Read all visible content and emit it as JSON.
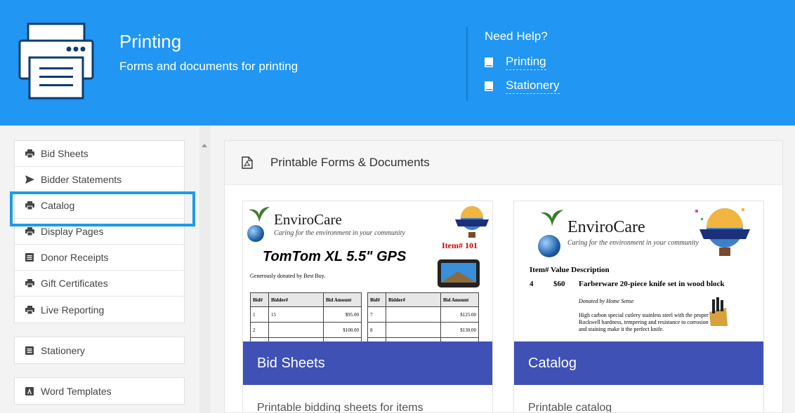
{
  "header": {
    "title": "Printing",
    "subtitle": "Forms and documents for printing",
    "help_title": "Need Help?",
    "help_links": [
      "Printing",
      "Stationery"
    ],
    "bg_color": "#2196f3"
  },
  "sidebar": {
    "group1": [
      {
        "label": "Bid Sheets",
        "icon": "printer-icon"
      },
      {
        "label": "Bidder Statements",
        "icon": "send-icon"
      },
      {
        "label": "Catalog",
        "icon": "printer-icon",
        "active": true
      },
      {
        "label": "Display Pages",
        "icon": "printer-icon"
      },
      {
        "label": "Donor Receipts",
        "icon": "list-icon"
      },
      {
        "label": "Gift Certificates",
        "icon": "printer-icon"
      },
      {
        "label": "Live Reporting",
        "icon": "printer-icon"
      }
    ],
    "group2": [
      {
        "label": "Stationery",
        "icon": "list-icon"
      }
    ],
    "group3": [
      {
        "label": "Word Templates",
        "icon": "word-icon"
      }
    ],
    "highlight_color": "#1e9be8"
  },
  "main": {
    "panel_title": "Printable Forms & Documents",
    "cards": [
      {
        "title": "Bid Sheets",
        "desc": "Printable bidding sheets for items"
      },
      {
        "title": "Catalog",
        "desc": "Printable catalog"
      }
    ],
    "card_bar_color": "#3f51b5"
  },
  "thumb_bids": {
    "brand": "EnviroCare",
    "tagline": "Caring for the environment in your community",
    "headline": "TomTom XL 5.5\" GPS",
    "item_no": "Item# 101",
    "donated": "Generously donated by Best Buy.",
    "col_bid": "Bid#",
    "col_bidder": "Bidder#",
    "col_amount": "Bid Amount",
    "left_rows": [
      [
        "1",
        "15",
        "$95.00"
      ],
      [
        "2",
        "",
        "$100.00"
      ]
    ],
    "right_rows": [
      [
        "7",
        "",
        "$125.00"
      ],
      [
        "8",
        "",
        "$130.00"
      ]
    ]
  },
  "thumb_catalog": {
    "brand": "EnviroCare",
    "tagline": "Caring for the environment in your community",
    "header": "Item#  Value  Description",
    "item": "4",
    "value": "$60",
    "desc": "Farberware 20-piece knife set in wood block",
    "donor": "Donated by Home Sense",
    "body": "High carbon special cutlery stainless steel with the proper Rockwell hardness, tempering and resistance to corrosion and staining make it the perfect knife."
  }
}
